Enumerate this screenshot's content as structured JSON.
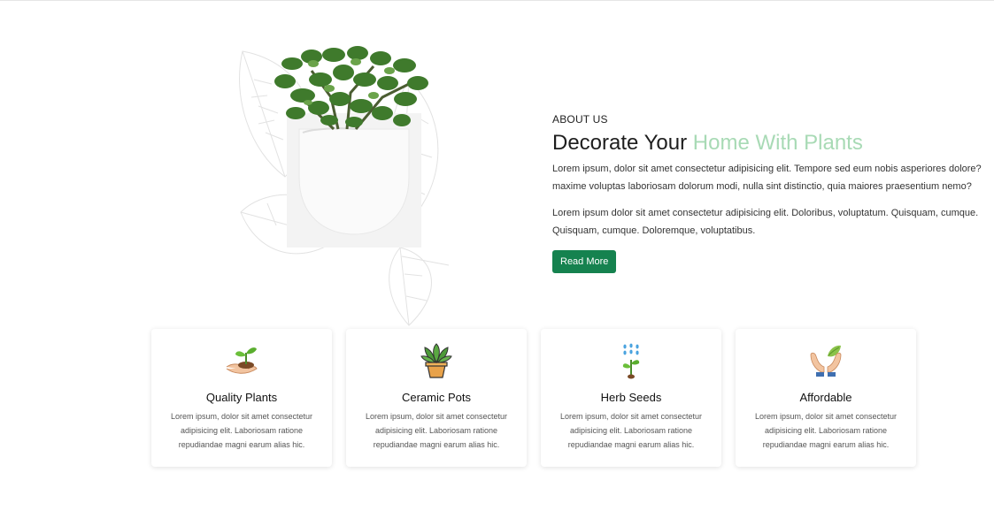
{
  "about": {
    "kicker": "ABOUT US",
    "title_main": "Decorate Your",
    "title_accent": "Home With Plants",
    "paragraph_1_line_1": "Lorem ipsum, dolor sit amet consectetur adipisicing elit. Tempore sed eum nobis asperiores dolore?",
    "paragraph_1_line_2": "maxime voluptas laboriosam dolorum modi, nulla sint distinctio, quia maiores praesentium nemo?",
    "paragraph_2_line_1": "Lorem ipsum dolor sit amet consectetur adipisicing elit. Doloribus, voluptatum. Quisquam, cumque.",
    "paragraph_2_line_2": "Quisquam, cumque. Doloremque, voluptatibus.",
    "button_label": "Read More"
  },
  "colors": {
    "accent_green": "#a8dab5",
    "button_green": "#15824f"
  },
  "features": [
    {
      "icon": "hand-sprout-icon",
      "title": "Quality Plants",
      "line_1": "Lorem ipsum, dolor sit amet consectetur",
      "line_2": "adipisicing elit. Laboriosam ratione",
      "line_3": "repudiandae magni earum alias hic."
    },
    {
      "icon": "potted-plant-icon",
      "title": "Ceramic Pots",
      "line_1": "Lorem ipsum, dolor sit amet consectetur",
      "line_2": "adipisicing elit. Laboriosam ratione",
      "line_3": "repudiandae magni earum alias hic."
    },
    {
      "icon": "watering-seed-icon",
      "title": "Herb Seeds",
      "line_1": "Lorem ipsum, dolor sit amet consectetur",
      "line_2": "adipisicing elit. Laboriosam ratione",
      "line_3": "repudiandae magni earum alias hic."
    },
    {
      "icon": "hands-leaf-icon",
      "title": "Affordable",
      "line_1": "Lorem ipsum, dolor sit amet consectetur",
      "line_2": "adipisicing elit. Laboriosam ratione",
      "line_3": "repudiandae magni earum alias hic."
    }
  ]
}
